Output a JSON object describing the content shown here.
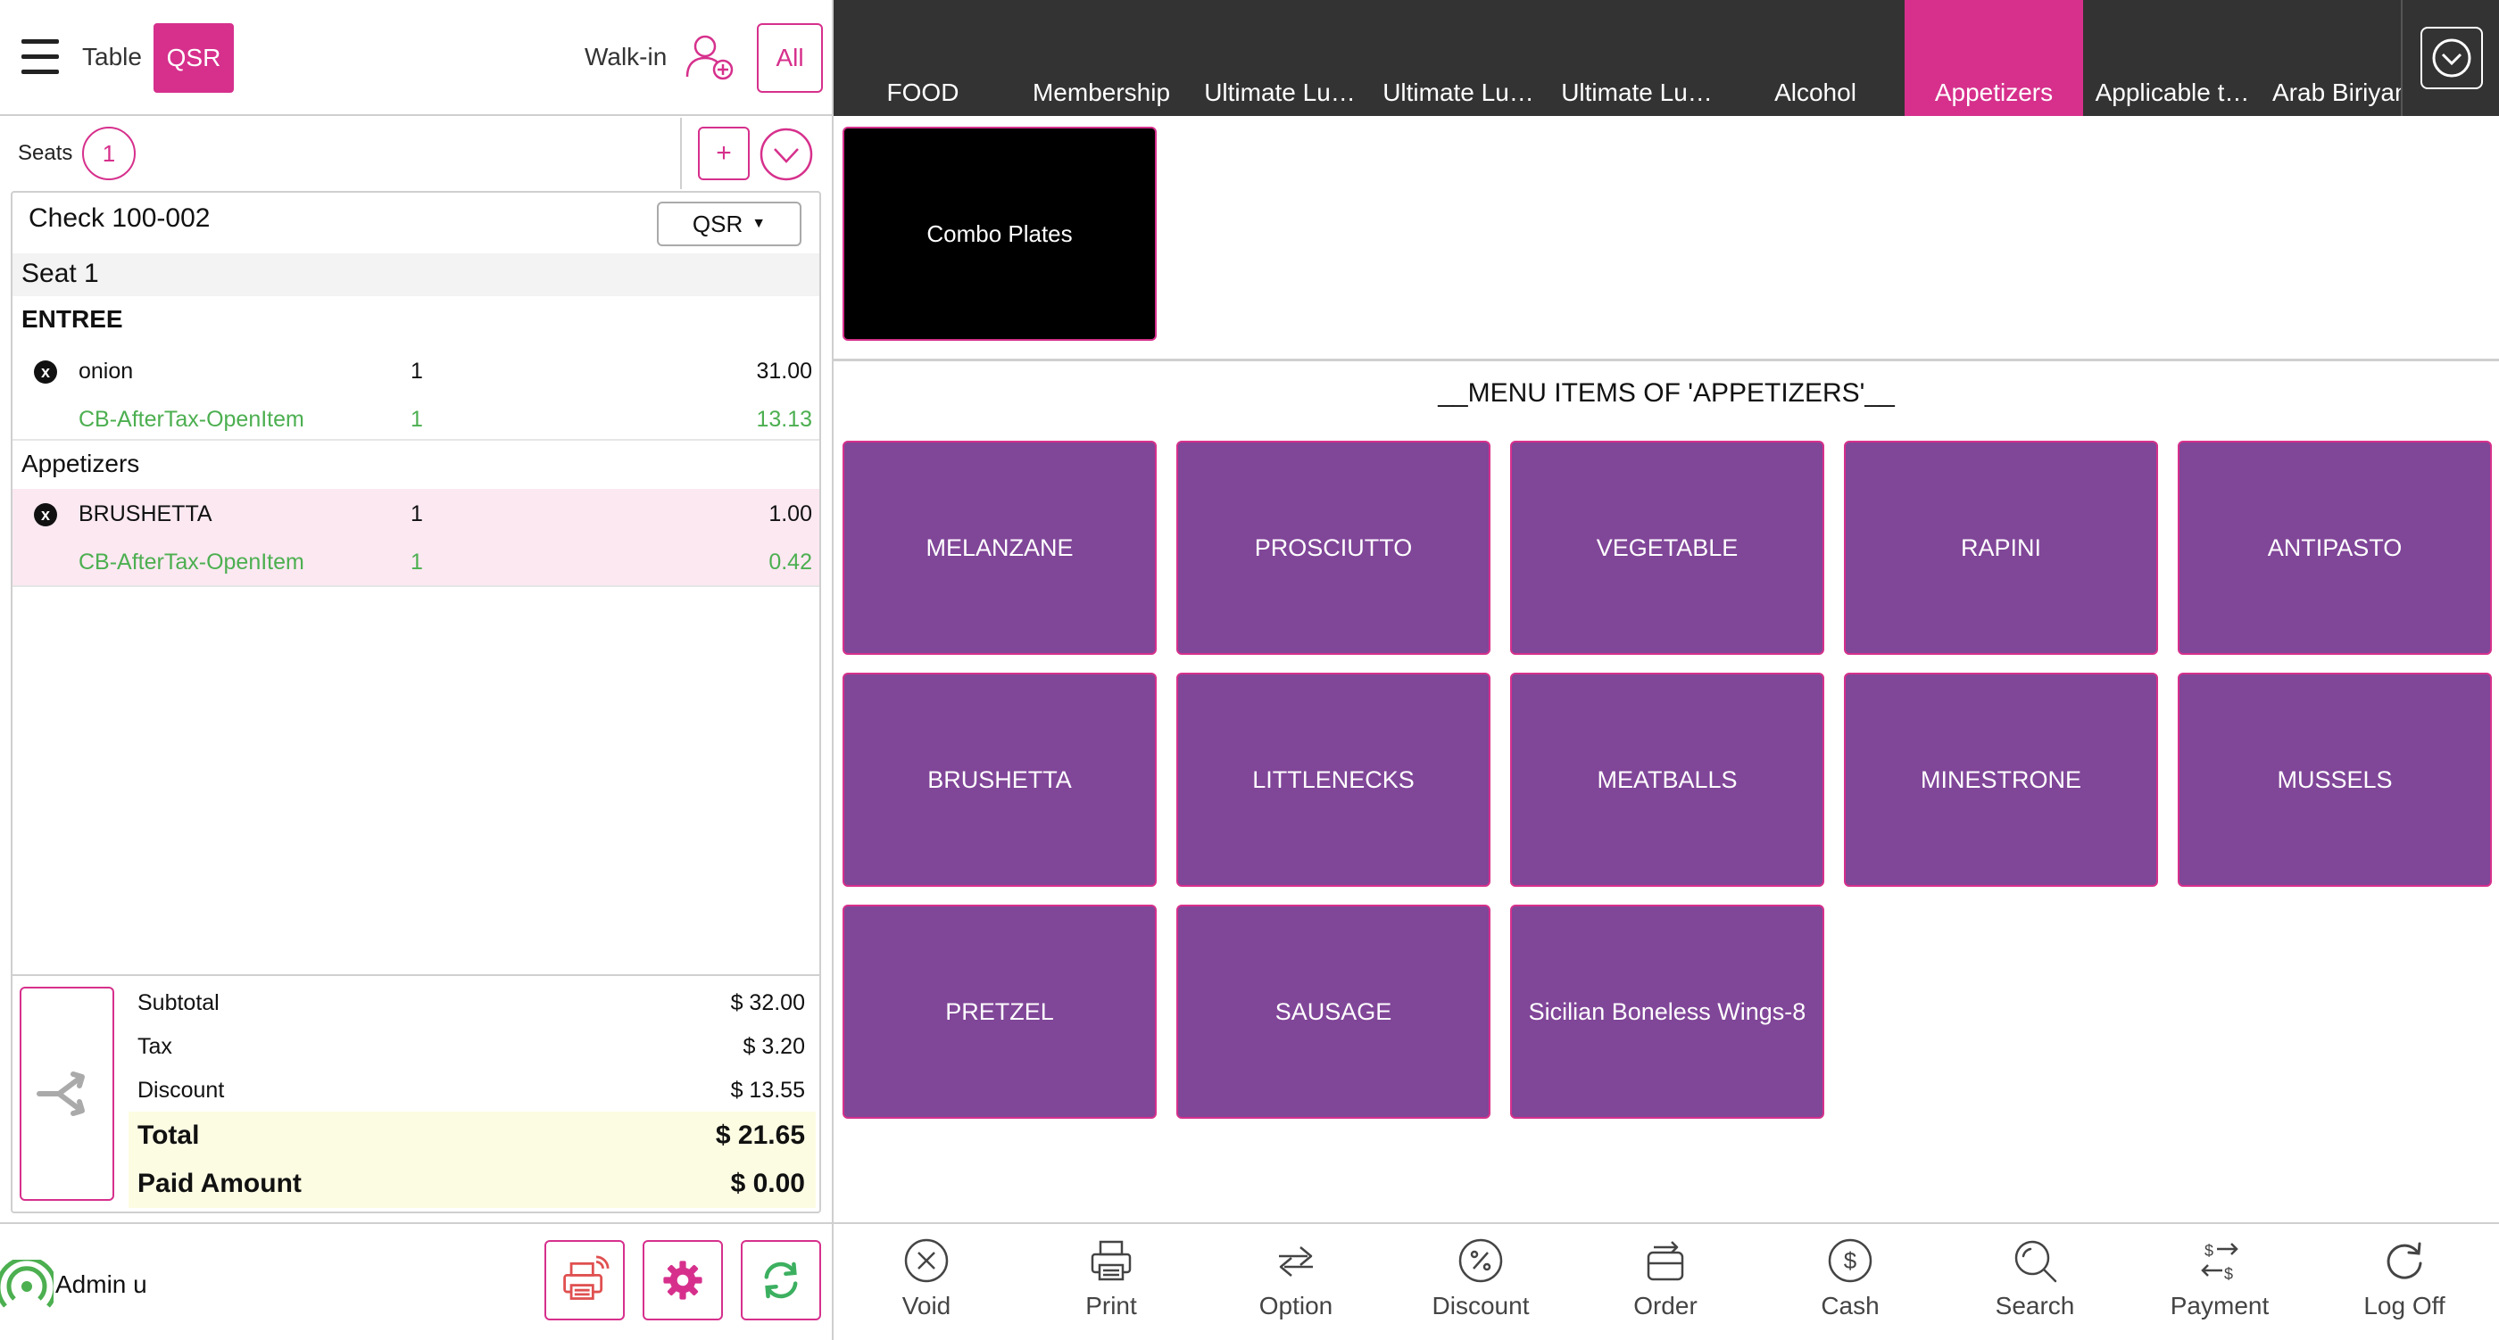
{
  "header": {
    "table_label": "Table",
    "qsr_label": "QSR",
    "walkin_label": "Walk-in",
    "all_label": "All"
  },
  "seats": {
    "label": "Seats",
    "count": "1",
    "add_label": "+"
  },
  "check": {
    "title": "Check 100-002",
    "order_type": "QSR",
    "seat_label": "Seat 1",
    "sections": [
      {
        "name": "ENTREE",
        "items": [
          {
            "name": "onion",
            "qty": "1",
            "price": "31.00"
          },
          {
            "name": "CB-AfterTax-OpenItem",
            "qty": "1",
            "price": "13.13"
          }
        ]
      },
      {
        "name": "Appetizers",
        "items": [
          {
            "name": "BRUSHETTA",
            "qty": "1",
            "price": "1.00"
          },
          {
            "name": "CB-AfterTax-OpenItem",
            "qty": "1",
            "price": "0.42"
          }
        ]
      }
    ],
    "remove_glyph": "x"
  },
  "totals": {
    "subtotal_label": "Subtotal",
    "subtotal": "$ 32.00",
    "tax_label": "Tax",
    "tax": "$ 3.20",
    "discount_label": "Discount",
    "discount": "$ 13.55",
    "total_label": "Total",
    "total": "$ 21.65",
    "paid_label": "Paid Amount",
    "paid": "$ 0.00"
  },
  "footer_left": {
    "user": "Admin u",
    "buttons": [
      "printer-icon",
      "gear-icon",
      "refresh-icon"
    ]
  },
  "tabs": [
    {
      "label": "FOOD"
    },
    {
      "label": "Membership"
    },
    {
      "label": "Ultimate Lu…"
    },
    {
      "label": "Ultimate Lu…"
    },
    {
      "label": "Ultimate Lu…"
    },
    {
      "label": "Alcohol"
    },
    {
      "label": "Appetizers",
      "active": true
    },
    {
      "label": "Applicable t…"
    },
    {
      "label": "Arab Biriyani"
    }
  ],
  "subcategory": {
    "label": "Combo Plates"
  },
  "menu": {
    "title": "__MENU ITEMS OF 'APPETIZERS'__",
    "items": [
      "MELANZANE",
      "PROSCIUTTO",
      "VEGETABLE",
      "RAPINI",
      "ANTIPASTO",
      "BRUSHETTA",
      "LITTLENECKS",
      "MEATBALLS",
      "MINESTRONE",
      "MUSSELS",
      "PRETZEL",
      "SAUSAGE",
      "Sicilian Boneless Wings-8"
    ]
  },
  "actions": [
    {
      "label": "Void",
      "icon": "void-icon"
    },
    {
      "label": "Print",
      "icon": "print-icon"
    },
    {
      "label": "Option",
      "icon": "option-icon"
    },
    {
      "label": "Discount",
      "icon": "discount-icon"
    },
    {
      "label": "Order",
      "icon": "order-icon"
    },
    {
      "label": "Cash",
      "icon": "cash-icon"
    },
    {
      "label": "Search",
      "icon": "search-icon"
    },
    {
      "label": "Payment",
      "icon": "payment-icon"
    },
    {
      "label": "Log Off",
      "icon": "logoff-icon"
    }
  ],
  "colors": {
    "accent": "#d6308c",
    "tile": "#804698",
    "tabbar": "#333333",
    "modifier": "#4caf50",
    "highlight_row": "#fbe8f1",
    "totals_bg": "#fcfce3"
  }
}
